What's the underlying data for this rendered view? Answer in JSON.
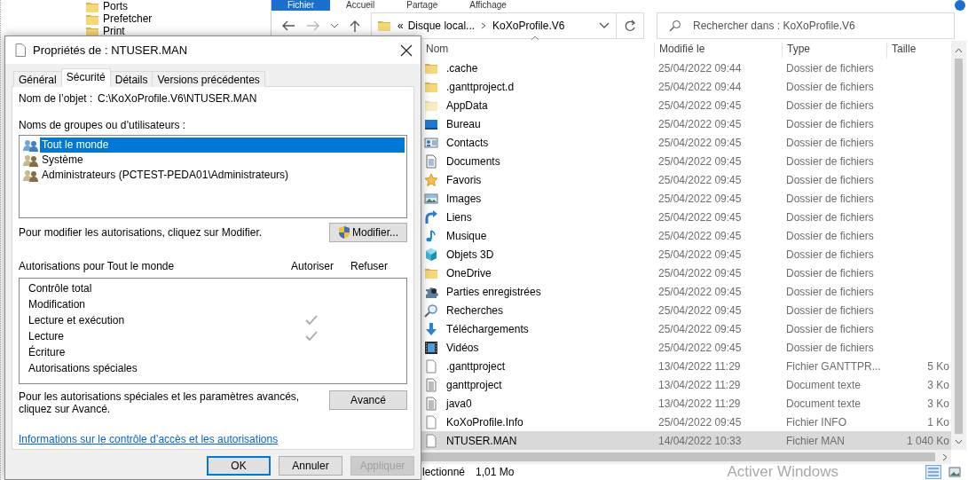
{
  "tree": {
    "items": [
      {
        "label": "Ports"
      },
      {
        "label": "Prefetcher"
      },
      {
        "label": "Print"
      }
    ]
  },
  "explorer": {
    "ribbon_tabs": [
      {
        "label": "Fichier",
        "selected": true
      },
      {
        "label": "Accueil",
        "selected": false
      },
      {
        "label": "Partage",
        "selected": false
      },
      {
        "label": "Affichage",
        "selected": false
      }
    ],
    "address": {
      "overflow": "«",
      "crumbs": [
        "Disque local...",
        "KoXoProfile.V6"
      ]
    },
    "search": {
      "placeholder": "Rechercher dans : KoXoProfile.V6"
    },
    "columns": [
      "Nom",
      "Modifié le",
      "Type",
      "Taille"
    ],
    "rows": [
      {
        "kind": "folder",
        "name": ".cache",
        "modified": "25/04/2022 09:44",
        "type": "Dossier de fichiers",
        "selected": false
      },
      {
        "kind": "folder",
        "name": ".ganttproject.d",
        "modified": "25/04/2022 09:44",
        "type": "Dossier de fichiers",
        "selected": false
      },
      {
        "kind": "hidden",
        "name": "AppData",
        "modified": "25/04/2022 09:45",
        "type": "Dossier de fichiers",
        "selected": false
      },
      {
        "kind": "desktop",
        "name": "Bureau",
        "modified": "25/04/2022 09:45",
        "type": "Dossier de fichiers",
        "selected": false
      },
      {
        "kind": "contacts",
        "name": "Contacts",
        "modified": "25/04/2022 09:45",
        "type": "Dossier de fichiers",
        "selected": false
      },
      {
        "kind": "documents",
        "name": "Documents",
        "modified": "25/04/2022 09:45",
        "type": "Dossier de fichiers",
        "selected": false
      },
      {
        "kind": "favorites",
        "name": "Favoris",
        "modified": "25/04/2022 09:45",
        "type": "Dossier de fichiers",
        "selected": false
      },
      {
        "kind": "pictures",
        "name": "Images",
        "modified": "25/04/2022 09:45",
        "type": "Dossier de fichiers",
        "selected": false
      },
      {
        "kind": "links",
        "name": "Liens",
        "modified": "25/04/2022 09:45",
        "type": "Dossier de fichiers",
        "selected": false
      },
      {
        "kind": "music",
        "name": "Musique",
        "modified": "25/04/2022 09:45",
        "type": "Dossier de fichiers",
        "selected": false
      },
      {
        "kind": "objects",
        "name": "Objets 3D",
        "modified": "25/04/2022 09:45",
        "type": "Dossier de fichiers",
        "selected": false
      },
      {
        "kind": "folder",
        "name": "OneDrive",
        "modified": "25/04/2022 09:45",
        "type": "Dossier de fichiers",
        "selected": false
      },
      {
        "kind": "games",
        "name": "Parties enregistrées",
        "modified": "25/04/2022 09:45",
        "type": "Dossier de fichiers",
        "selected": false
      },
      {
        "kind": "searches",
        "name": "Recherches",
        "modified": "25/04/2022 09:45",
        "type": "Dossier de fichiers",
        "selected": false
      },
      {
        "kind": "downloads",
        "name": "Téléchargements",
        "modified": "25/04/2022 09:45",
        "type": "Dossier de fichiers",
        "selected": false
      },
      {
        "kind": "videos",
        "name": "Vidéos",
        "modified": "25/04/2022 09:45",
        "type": "Dossier de fichiers",
        "selected": false
      },
      {
        "kind": "file",
        "name": ".ganttproject",
        "modified": "13/04/2022 11:29",
        "type": "Fichier GANTTPR...",
        "size": "5 Ko",
        "selected": false
      },
      {
        "kind": "text",
        "name": "ganttproject",
        "modified": "13/04/2022 11:29",
        "type": "Document texte",
        "size": "3 Ko",
        "selected": false
      },
      {
        "kind": "text",
        "name": "java0",
        "modified": "13/04/2022 11:29",
        "type": "Document texte",
        "size": "3 Ko",
        "selected": false
      },
      {
        "kind": "file",
        "name": "KoXoProfile.Info",
        "modified": "25/04/2022 09:45",
        "type": "Fichier INFO",
        "size": "1 Ko",
        "selected": false
      },
      {
        "kind": "file",
        "name": "NTUSER.MAN",
        "modified": "14/04/2022 10:33",
        "type": "Fichier MAN",
        "size": "1 040 Ko",
        "selected": true
      }
    ],
    "status": {
      "selection": "lectionné",
      "size": "1,01 Mo"
    },
    "activation_notice": "Activer Windows"
  },
  "dialog": {
    "title": "Propriétés de : NTUSER.MAN",
    "tabs": [
      {
        "label": "Général",
        "selected": false
      },
      {
        "label": "Sécurité",
        "selected": true
      },
      {
        "label": "Détails",
        "selected": false
      },
      {
        "label": "Versions précédentes",
        "selected": false
      }
    ],
    "object_label": "Nom de l’objet :",
    "object_path": "C:\\KoXoProfile.V6\\NTUSER.MAN",
    "groups_label": "Noms de groupes ou d’utilisateurs :",
    "groups": [
      {
        "name": "Tout le monde",
        "selected": true
      },
      {
        "name": "Système",
        "selected": false
      },
      {
        "name": "Administrateurs (PCTEST-PEDA01\\Administrateurs)",
        "selected": false
      }
    ],
    "modify_hint": "Pour modifier les autorisations, cliquez sur Modifier.",
    "modify_button": "Modifier...",
    "permissions_label": "Autorisations pour Tout le monde",
    "allow_header": "Autoriser",
    "deny_header": "Refuser",
    "permissions": [
      {
        "name": "Contrôle total",
        "allow": false,
        "deny": false
      },
      {
        "name": "Modification",
        "allow": false,
        "deny": false
      },
      {
        "name": "Lecture et exécution",
        "allow": true,
        "deny": false
      },
      {
        "name": "Lecture",
        "allow": true,
        "deny": false
      },
      {
        "name": "Écriture",
        "allow": false,
        "deny": false
      },
      {
        "name": "Autorisations spéciales",
        "allow": false,
        "deny": false
      }
    ],
    "advanced_hint": "Pour les autorisations spéciales et les paramètres avancés, cliquez sur Avancé.",
    "advanced_button": "Avancé",
    "link": "Informations sur le contrôle d’accès et les autorisations",
    "buttons": [
      {
        "label": "OK",
        "default": true,
        "disabled": false
      },
      {
        "label": "Annuler",
        "default": false,
        "disabled": false
      },
      {
        "label": "Appliquer",
        "default": false,
        "disabled": true
      }
    ]
  }
}
